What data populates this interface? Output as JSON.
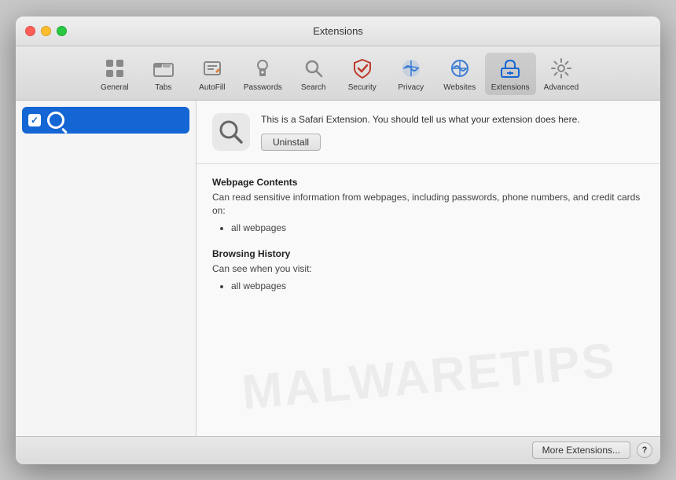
{
  "window": {
    "title": "Extensions"
  },
  "toolbar": {
    "items": [
      {
        "id": "general",
        "label": "General",
        "icon": "general"
      },
      {
        "id": "tabs",
        "label": "Tabs",
        "icon": "tabs"
      },
      {
        "id": "autofill",
        "label": "AutoFill",
        "icon": "autofill"
      },
      {
        "id": "passwords",
        "label": "Passwords",
        "icon": "passwords"
      },
      {
        "id": "search",
        "label": "Search",
        "icon": "search"
      },
      {
        "id": "security",
        "label": "Security",
        "icon": "security"
      },
      {
        "id": "privacy",
        "label": "Privacy",
        "icon": "privacy"
      },
      {
        "id": "websites",
        "label": "Websites",
        "icon": "websites"
      },
      {
        "id": "extensions",
        "label": "Extensions",
        "icon": "extensions",
        "active": true
      },
      {
        "id": "advanced",
        "label": "Advanced",
        "icon": "advanced"
      }
    ]
  },
  "sidebar": {
    "items": [
      {
        "id": "search-ext",
        "label": "",
        "checked": true,
        "selected": true
      }
    ]
  },
  "extension": {
    "description": "This is a Safari Extension. You should tell us what your extension does here.",
    "uninstall_label": "Uninstall",
    "permissions": [
      {
        "title": "Webpage Contents",
        "description": "Can read sensitive information from webpages, including passwords, phone numbers, and credit cards on:",
        "items": [
          "all webpages"
        ]
      },
      {
        "title": "Browsing History",
        "description": "Can see when you visit:",
        "items": [
          "all webpages"
        ]
      }
    ]
  },
  "footer": {
    "more_extensions_label": "More Extensions...",
    "help_label": "?"
  }
}
